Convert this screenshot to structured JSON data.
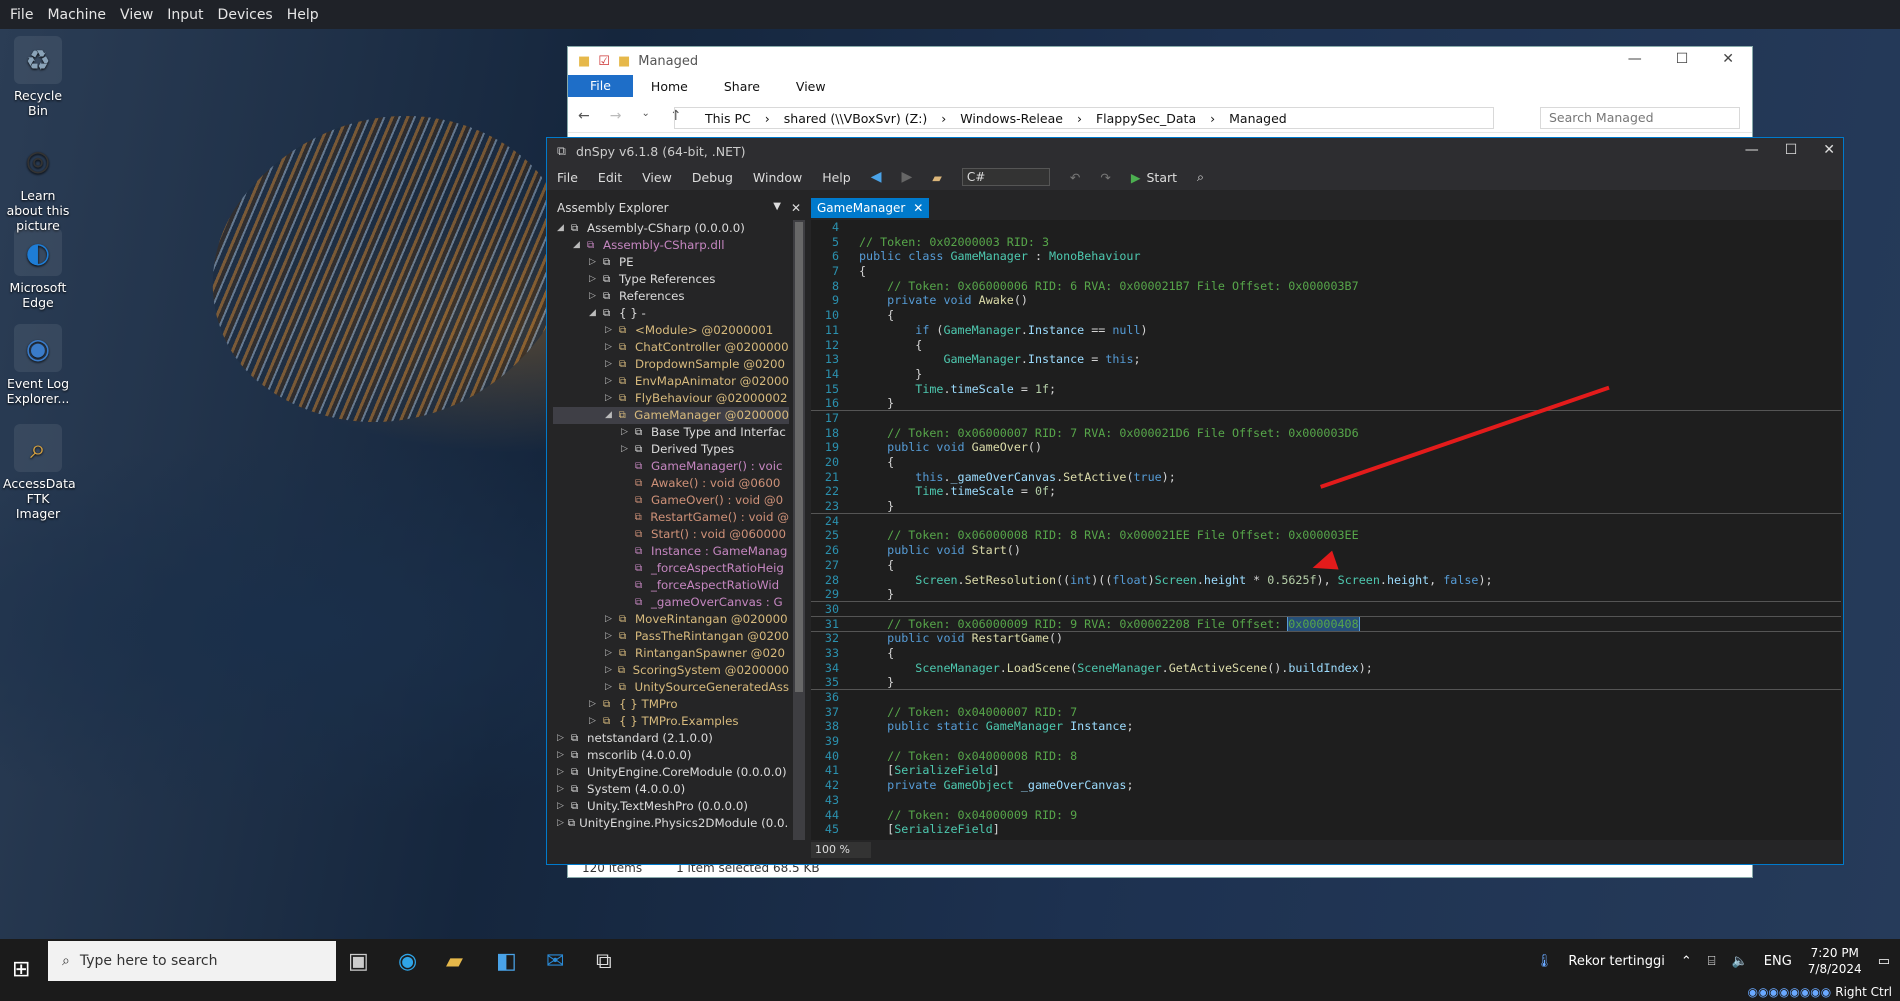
{
  "host_menu": [
    "File",
    "Machine",
    "View",
    "Input",
    "Devices",
    "Help"
  ],
  "desktop_icons": [
    {
      "label": "Recycle Bin",
      "icon": "recycle-bin-icon"
    },
    {
      "label": "Learn about this picture",
      "icon": "camera-icon"
    },
    {
      "label": "Microsoft Edge",
      "icon": "edge-icon"
    },
    {
      "label": "Event Log Explorer...",
      "icon": "event-log-icon"
    },
    {
      "label": "AccessData FTK Imager",
      "icon": "ftk-imager-icon"
    }
  ],
  "explorer": {
    "title": "Managed",
    "ribbon": [
      "File",
      "Home",
      "Share",
      "View"
    ],
    "path": [
      "This PC",
      "shared (\\\\VBoxSvr) (Z:)",
      "Windows-Releae",
      "FlappySec_Data",
      "Managed"
    ],
    "search_placeholder": "Search Managed",
    "status_items": "120 items",
    "status_selected": "1 item selected  68.5 KB"
  },
  "dnspy": {
    "title": "dnSpy v6.1.8 (64-bit, .NET)",
    "menu": [
      "File",
      "Edit",
      "View",
      "Debug",
      "Window",
      "Help"
    ],
    "language": "C#",
    "start_label": "Start",
    "panel_title": "Assembly Explorer",
    "tab_label": "GameManager",
    "zoom": "100 %",
    "tree": [
      {
        "indent": 0,
        "text": "Assembly-CSharp (0.0.0.0)",
        "arrow": "open",
        "color": "#dcdcdc"
      },
      {
        "indent": 1,
        "text": "Assembly-CSharp.dll",
        "arrow": "open",
        "color": "#c586c0"
      },
      {
        "indent": 2,
        "text": "PE",
        "arrow": "closed",
        "color": "#dcdcdc"
      },
      {
        "indent": 2,
        "text": "Type References",
        "arrow": "closed",
        "color": "#dcdcdc"
      },
      {
        "indent": 2,
        "text": "References",
        "arrow": "closed",
        "color": "#dcdcdc"
      },
      {
        "indent": 2,
        "text": "{ }  -",
        "arrow": "open",
        "color": "#dcdcdc"
      },
      {
        "indent": 3,
        "text": "<Module> @02000001",
        "arrow": "closed",
        "color": "#d7ba7d"
      },
      {
        "indent": 3,
        "text": "ChatController @0200000",
        "arrow": "closed",
        "color": "#d7ba7d"
      },
      {
        "indent": 3,
        "text": "DropdownSample @0200",
        "arrow": "closed",
        "color": "#d7ba7d"
      },
      {
        "indent": 3,
        "text": "EnvMapAnimator @02000",
        "arrow": "closed",
        "color": "#d7ba7d"
      },
      {
        "indent": 3,
        "text": "FlyBehaviour @02000002",
        "arrow": "closed",
        "color": "#d7ba7d"
      },
      {
        "indent": 3,
        "text": "GameManager @0200000",
        "arrow": "open",
        "color": "#d7ba7d",
        "sel": true
      },
      {
        "indent": 4,
        "text": "Base Type and Interfac",
        "arrow": "closed",
        "color": "#dcdcdc"
      },
      {
        "indent": 4,
        "text": "Derived Types",
        "arrow": "closed",
        "color": "#dcdcdc"
      },
      {
        "indent": 4,
        "text": "GameManager() : voic",
        "arrow": "none",
        "color": "#c586c0"
      },
      {
        "indent": 4,
        "text": "Awake() : void @0600",
        "arrow": "none",
        "color": "#ce9178"
      },
      {
        "indent": 4,
        "text": "GameOver() : void @0",
        "arrow": "none",
        "color": "#ce9178"
      },
      {
        "indent": 4,
        "text": "RestartGame() : void @",
        "arrow": "none",
        "color": "#ce9178"
      },
      {
        "indent": 4,
        "text": "Start() : void @060000",
        "arrow": "none",
        "color": "#ce9178"
      },
      {
        "indent": 4,
        "text": "Instance : GameManag",
        "arrow": "none",
        "color": "#c586c0"
      },
      {
        "indent": 4,
        "text": "_forceAspectRatioHeig",
        "arrow": "none",
        "color": "#c586c0"
      },
      {
        "indent": 4,
        "text": "_forceAspectRatioWid",
        "arrow": "none",
        "color": "#c586c0"
      },
      {
        "indent": 4,
        "text": "_gameOverCanvas : G",
        "arrow": "none",
        "color": "#c586c0"
      },
      {
        "indent": 3,
        "text": "MoveRintangan @020000",
        "arrow": "closed",
        "color": "#d7ba7d"
      },
      {
        "indent": 3,
        "text": "PassTheRintangan @0200",
        "arrow": "closed",
        "color": "#d7ba7d"
      },
      {
        "indent": 3,
        "text": "RintanganSpawner @020",
        "arrow": "closed",
        "color": "#d7ba7d"
      },
      {
        "indent": 3,
        "text": "ScoringSystem @0200000",
        "arrow": "closed",
        "color": "#d7ba7d"
      },
      {
        "indent": 3,
        "text": "UnitySourceGeneratedAss",
        "arrow": "closed",
        "color": "#d7ba7d"
      },
      {
        "indent": 2,
        "text": "{ }  TMPro",
        "arrow": "closed",
        "color": "#d7ba7d"
      },
      {
        "indent": 2,
        "text": "{ }  TMPro.Examples",
        "arrow": "closed",
        "color": "#d7ba7d"
      },
      {
        "indent": 0,
        "text": "netstandard (2.1.0.0)",
        "arrow": "closed",
        "color": "#dcdcdc"
      },
      {
        "indent": 0,
        "text": "mscorlib (4.0.0.0)",
        "arrow": "closed",
        "color": "#dcdcdc"
      },
      {
        "indent": 0,
        "text": "UnityEngine.CoreModule (0.0.0.0)",
        "arrow": "closed",
        "color": "#dcdcdc"
      },
      {
        "indent": 0,
        "text": "System (4.0.0.0)",
        "arrow": "closed",
        "color": "#dcdcdc"
      },
      {
        "indent": 0,
        "text": "Unity.TextMeshPro (0.0.0.0)",
        "arrow": "closed",
        "color": "#dcdcdc"
      },
      {
        "indent": 0,
        "text": "UnityEngine.Physics2DModule (0.0.0",
        "arrow": "closed",
        "color": "#dcdcdc"
      }
    ],
    "code_lines": [
      {
        "n": "4",
        "h": ""
      },
      {
        "n": "5",
        "h": "<span class='cm'>// Token: 0x02000003 RID: 3</span>"
      },
      {
        "n": "6",
        "h": "<span class='kw'>public class</span> <span class='ty'>GameManager</span> : <span class='ty'>MonoBehaviour</span>"
      },
      {
        "n": "7",
        "h": "{"
      },
      {
        "n": "8",
        "h": "    <span class='cm'>// Token: 0x06000006 RID: 6 RVA: 0x000021B7 File Offset: 0x000003B7</span>"
      },
      {
        "n": "9",
        "h": "    <span class='kw'>private void</span> <span class='fn'>Awake</span>()"
      },
      {
        "n": "10",
        "h": "    {"
      },
      {
        "n": "11",
        "h": "        <span class='kw'>if</span> (<span class='ty'>GameManager</span>.<span class='pr'>Instance</span> == <span class='kw'>null</span>)"
      },
      {
        "n": "12",
        "h": "        {"
      },
      {
        "n": "13",
        "h": "            <span class='ty'>GameManager</span>.<span class='pr'>Instance</span> = <span class='kw'>this</span>;"
      },
      {
        "n": "14",
        "h": "        }"
      },
      {
        "n": "15",
        "h": "        <span class='ty'>Time</span>.<span class='pr'>timeScale</span> = <span class='nb'>1f</span>;"
      },
      {
        "n": "16",
        "h": "    }",
        "sep": true
      },
      {
        "n": "17",
        "h": ""
      },
      {
        "n": "18",
        "h": "    <span class='cm'>// Token: 0x06000007 RID: 7 RVA: 0x000021D6 File Offset: 0x000003D6</span>"
      },
      {
        "n": "19",
        "h": "    <span class='kw'>public void</span> <span class='fn'>GameOver</span>()"
      },
      {
        "n": "20",
        "h": "    {"
      },
      {
        "n": "21",
        "h": "        <span class='kw'>this</span>.<span class='pr'>_gameOverCanvas</span>.<span class='fn'>SetActive</span>(<span class='kw'>true</span>);"
      },
      {
        "n": "22",
        "h": "        <span class='ty'>Time</span>.<span class='pr'>timeScale</span> = <span class='nb'>0f</span>;"
      },
      {
        "n": "23",
        "h": "    }",
        "sep": true
      },
      {
        "n": "24",
        "h": ""
      },
      {
        "n": "25",
        "h": "    <span class='cm'>// Token: 0x06000008 RID: 8 RVA: 0x000021EE File Offset: 0x000003EE</span>"
      },
      {
        "n": "26",
        "h": "    <span class='kw'>public void</span> <span class='fn'>Start</span>()"
      },
      {
        "n": "27",
        "h": "    {"
      },
      {
        "n": "28",
        "h": "        <span class='ty'>Screen</span>.<span class='fn'>SetResolution</span>((<span class='kw'>int</span>)((<span class='kw'>float</span>)<span class='ty'>Screen</span>.<span class='pr'>height</span> * <span class='nb'>0.5625f</span>), <span class='ty'>Screen</span>.<span class='pr'>height</span>, <span class='kw'>false</span>);"
      },
      {
        "n": "29",
        "h": "    }",
        "sep": true
      },
      {
        "n": "30",
        "h": ""
      },
      {
        "n": "31",
        "h": "    <span class='cm'>// Token: 0x06000009 RID: 9 RVA: 0x00002208 File Offset: </span><span class='cm sel-tok'>0x00000408</span>",
        "hl": true
      },
      {
        "n": "32",
        "h": "    <span class='kw'>public void</span> <span class='fn'>RestartGame</span>()"
      },
      {
        "n": "33",
        "h": "    {"
      },
      {
        "n": "34",
        "h": "        <span class='ty'>SceneManager</span>.<span class='fn'>LoadScene</span>(<span class='ty'>SceneManager</span>.<span class='fn'>GetActiveScene</span>().<span class='pr'>buildIndex</span>);"
      },
      {
        "n": "35",
        "h": "    }",
        "sep": true
      },
      {
        "n": "36",
        "h": ""
      },
      {
        "n": "37",
        "h": "    <span class='cm'>// Token: 0x04000007 RID: 7</span>"
      },
      {
        "n": "38",
        "h": "    <span class='kw'>public static</span> <span class='ty'>GameManager</span> <span class='pr'>Instance</span>;"
      },
      {
        "n": "39",
        "h": ""
      },
      {
        "n": "40",
        "h": "    <span class='cm'>// Token: 0x04000008 RID: 8</span>"
      },
      {
        "n": "41",
        "h": "    [<span class='ty'>SerializeField</span>]"
      },
      {
        "n": "42",
        "h": "    <span class='kw'>private</span> <span class='ty'>GameObject</span> <span class='pr'>_gameOverCanvas</span>;"
      },
      {
        "n": "43",
        "h": ""
      },
      {
        "n": "44",
        "h": "    <span class='cm'>// Token: 0x04000009 RID: 9</span>"
      },
      {
        "n": "45",
        "h": "    [<span class='ty'>SerializeField</span>]"
      }
    ]
  },
  "taskbar": {
    "search_placeholder": "Type here to search",
    "weather": "Rekor tertinggi",
    "lang": "ENG",
    "time": "7:20 PM",
    "date": "7/8/2024",
    "host_key": "Right Ctrl"
  }
}
